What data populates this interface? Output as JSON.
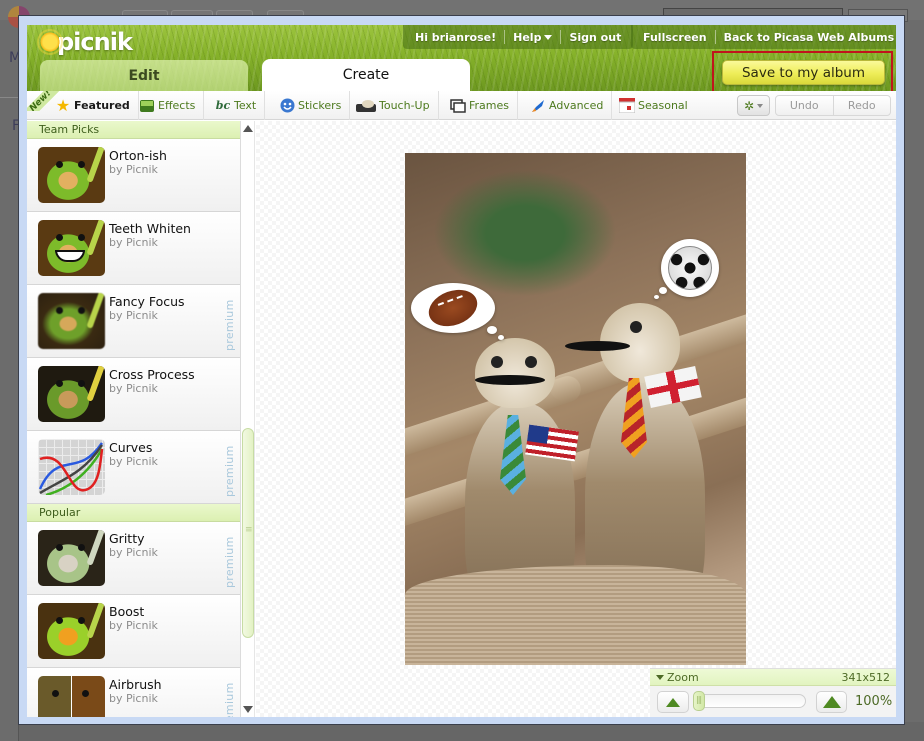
{
  "background_page": {
    "side_letters": [
      "M",
      "F"
    ]
  },
  "header": {
    "logo_text": "picnik",
    "greeting": "Hi brianrose!",
    "help_label": "Help",
    "signout_label": "Sign out",
    "fullscreen_label": "Fullscreen",
    "back_label": "Back to Picasa Web Albums",
    "tabs": [
      {
        "label": "Edit",
        "active": false
      },
      {
        "label": "Create",
        "active": true
      }
    ],
    "save_button_label": "Save to my album",
    "highlight_color": "#c0141c"
  },
  "toolbar": {
    "new_badge": "New!",
    "tools": [
      {
        "label": "Featured",
        "icon": "star-icon",
        "active": true
      },
      {
        "label": "Effects",
        "icon": "effects-icon",
        "active": false
      },
      {
        "label": "Text",
        "icon": "text-icon",
        "active": false
      },
      {
        "label": "Stickers",
        "icon": "sticker-smiley-icon",
        "active": false
      },
      {
        "label": "Touch-Up",
        "icon": "touchup-icon",
        "active": false
      },
      {
        "label": "Frames",
        "icon": "frames-icon",
        "active": false
      },
      {
        "label": "Advanced",
        "icon": "rocket-icon",
        "active": false
      },
      {
        "label": "Seasonal",
        "icon": "calendar-icon",
        "active": false
      }
    ],
    "undo_label": "Undo",
    "redo_label": "Redo"
  },
  "sidebar": {
    "sections": [
      {
        "title": "Team Picks",
        "items": [
          {
            "title": "Orton-ish",
            "author": "by Picnik",
            "premium": false
          },
          {
            "title": "Teeth Whiten",
            "author": "by Picnik",
            "premium": false
          },
          {
            "title": "Fancy Focus",
            "author": "by Picnik",
            "premium": true
          },
          {
            "title": "Cross Process",
            "author": "by Picnik",
            "premium": false
          },
          {
            "title": "Curves",
            "author": "by Picnik",
            "premium": true
          }
        ]
      },
      {
        "title": "Popular",
        "items": [
          {
            "title": "Gritty",
            "author": "by Picnik",
            "premium": true
          },
          {
            "title": "Boost",
            "author": "by Picnik",
            "premium": false
          },
          {
            "title": "Airbrush",
            "author": "by Picnik",
            "premium": true
          }
        ]
      }
    ],
    "premium_label": "premium"
  },
  "zoom_panel": {
    "title": "Zoom",
    "dimensions": "341x512",
    "percent": "100%",
    "slider_fraction": 0.0
  },
  "colors": {
    "accent_green": "#4d7a1e",
    "save_yellow": "#eeed58",
    "premium_blue": "#a9c8dc"
  }
}
